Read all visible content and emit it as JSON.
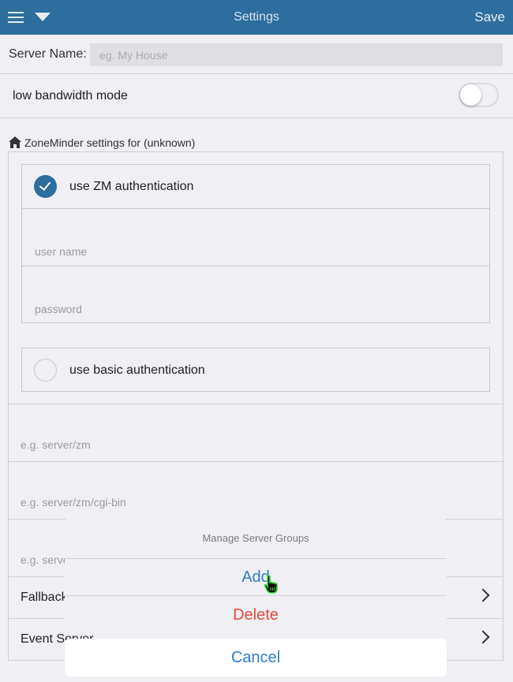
{
  "header": {
    "title": "Settings",
    "save_label": "Save"
  },
  "server_name": {
    "label": "Server Name:",
    "value": "",
    "placeholder": "eg. My House"
  },
  "low_bandwidth": {
    "label": "low bandwidth mode",
    "enabled": false
  },
  "zm_settings": {
    "heading": "ZoneMinder settings for (unknown)",
    "zm_auth": {
      "label": "use ZM authentication",
      "checked": true,
      "username_placeholder": "user name",
      "password_placeholder": "password"
    },
    "basic_auth": {
      "label": "use basic authentication",
      "checked": false
    },
    "portal_url_placeholder": "e.g. server/zm",
    "cgi_url_placeholder": "e.g. server/zm/cgi-bin",
    "api_url_placeholder": "e.g. server/zm/api",
    "fallback_label": "Fallback Configuration",
    "event_server_label": "Event Server"
  },
  "action_sheet": {
    "title": "Manage Server Groups",
    "add_label": "Add",
    "delete_label": "Delete",
    "cancel_label": "Cancel"
  },
  "colors": {
    "header": "#2e6e9e",
    "accent": "#2f7cc9",
    "destructive": "#e8493a",
    "background": "#efeff4"
  }
}
